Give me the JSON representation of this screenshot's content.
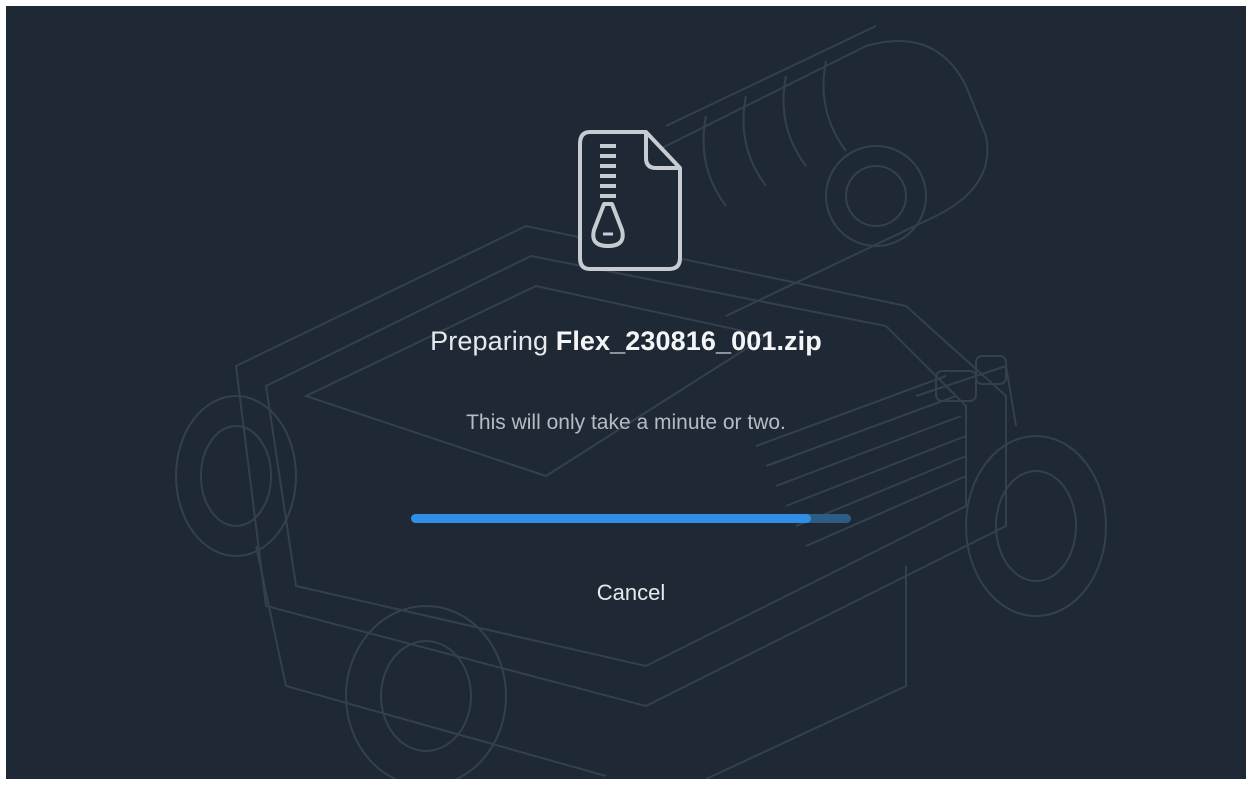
{
  "dialog": {
    "title_prefix": "Preparing ",
    "filename": "Flex_230816_001.zip",
    "subtitle": "This will only take a minute or two.",
    "progress_fraction": 0.91,
    "cancel_label": "Cancel"
  },
  "icons": {
    "main": "zip-file-icon",
    "background": "robot-device-illustration"
  },
  "colors": {
    "background": "#1f2935",
    "progress_fill": "#2f8ee6",
    "progress_track": "#2d5d84",
    "text_primary": "#e6e9ec",
    "text_secondary": "#b4bcc6"
  }
}
